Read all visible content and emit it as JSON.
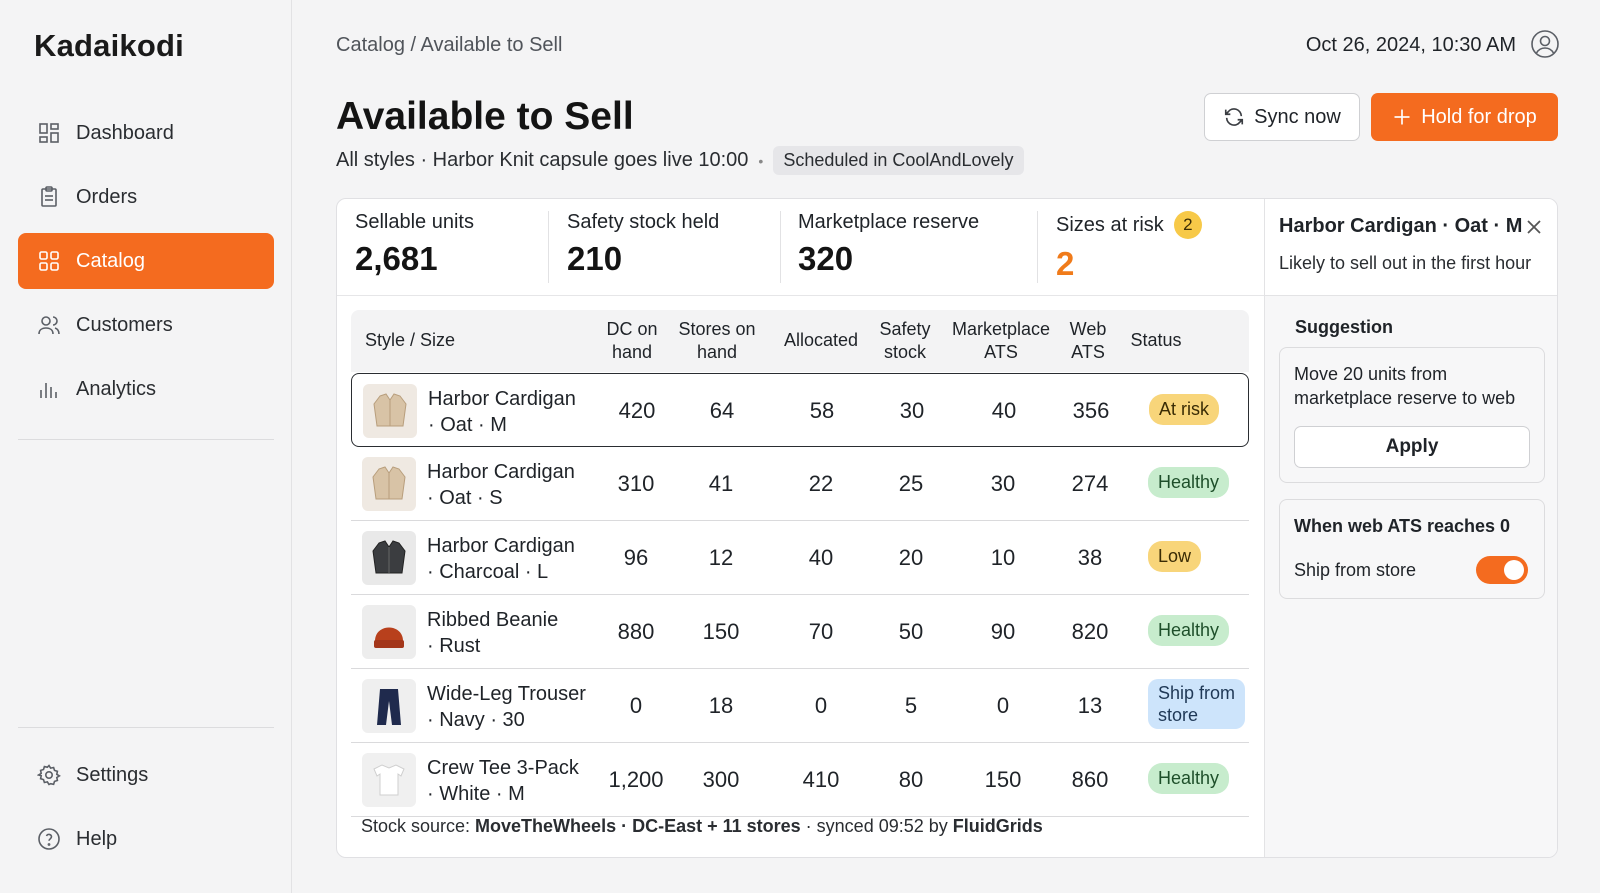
{
  "app": {
    "brand": "Kadaikodi"
  },
  "nav": {
    "items": [
      {
        "label": "Dashboard",
        "icon": "dashboard-icon"
      },
      {
        "label": "Orders",
        "icon": "clipboard-icon"
      },
      {
        "label": "Catalog",
        "icon": "grid-icon",
        "active": true
      },
      {
        "label": "Customers",
        "icon": "users-icon"
      },
      {
        "label": "Analytics",
        "icon": "bar-chart-icon"
      }
    ],
    "bottom": [
      {
        "label": "Settings",
        "icon": "gear-icon"
      },
      {
        "label": "Help",
        "icon": "help-icon"
      }
    ]
  },
  "header": {
    "breadcrumb": "Catalog / Available to Sell",
    "datetime": "Oct 26, 2024, 10:30 AM"
  },
  "page": {
    "title": "Available to Sell",
    "subtitle": "All styles · Harbor Knit capsule goes live 10:00",
    "separator": "•",
    "scheduled": "Scheduled in CoolAndLovely",
    "sync_label": "Sync now",
    "hold_label": "Hold for drop"
  },
  "kpis": {
    "sellable_label": "Sellable units",
    "sellable_value": "2,681",
    "safety_label": "Safety stock held",
    "safety_value": "210",
    "reserve_label": "Marketplace reserve",
    "reserve_value": "320",
    "risk_label": "Sizes at risk",
    "risk_badge": "2",
    "risk_value": "2"
  },
  "table": {
    "headers": {
      "style": "Style / Size",
      "dc": [
        "DC on",
        "hand"
      ],
      "stores": [
        "Stores on",
        "hand"
      ],
      "allocated": "Allocated",
      "safety": [
        "Safety",
        "stock"
      ],
      "marketplace": [
        "Marketplace",
        "ATS"
      ],
      "web": [
        "Web",
        "ATS"
      ],
      "status": "Status"
    },
    "rows": [
      {
        "name1": "Harbor Cardigan",
        "name2": "· Oat · M",
        "dc": "420",
        "stores": "64",
        "allocated": "58",
        "safety": "30",
        "marketplace": "40",
        "web": "356",
        "status": "At risk"
      },
      {
        "name1": "Harbor Cardigan",
        "name2": "· Oat · S",
        "dc": "310",
        "stores": "41",
        "allocated": "22",
        "safety": "25",
        "marketplace": "30",
        "web": "274",
        "status": "Healthy"
      },
      {
        "name1": "Harbor Cardigan",
        "name2": "· Charcoal · L",
        "dc": "96",
        "stores": "12",
        "allocated": "40",
        "safety": "20",
        "marketplace": "10",
        "web": "38",
        "status": "Low"
      },
      {
        "name1": "Ribbed Beanie",
        "name2": "· Rust",
        "dc": "880",
        "stores": "150",
        "allocated": "70",
        "safety": "50",
        "marketplace": "90",
        "web": "820",
        "status": "Healthy"
      },
      {
        "name1": "Wide-Leg Trouser",
        "name2": "· Navy · 30",
        "dc": "0",
        "stores": "18",
        "allocated": "0",
        "safety": "5",
        "marketplace": "0",
        "web": "13",
        "status1": "Ship from",
        "status2": "store"
      },
      {
        "name1": "Crew Tee 3-Pack",
        "name2": "· White · M",
        "dc": "1,200",
        "stores": "300",
        "allocated": "410",
        "safety": "80",
        "marketplace": "150",
        "web": "860",
        "status": "Healthy"
      }
    ]
  },
  "source": {
    "prefix": "Stock source: ",
    "system": "MoveTheWheels",
    "sep1": " · ",
    "location": "DC-East + 11 stores",
    "middle": " · synced 09:52 by ",
    "syncer": "FluidGrids"
  },
  "panel": {
    "title": "Harbor Cardigan · Oat · M",
    "subtitle": "Likely to sell out in the first hour",
    "suggestion_label": "Suggestion",
    "suggestion_text": "Move 20 units from marketplace reserve to web",
    "apply_label": "Apply",
    "rule_title": "When web ATS reaches 0",
    "rule_label": "Ship from store",
    "rule_enabled": true
  },
  "colors": {
    "accent": "#f46b1f",
    "healthy": "#c7eccd",
    "risk": "#f8d57a",
    "ship": "#cde4fb"
  }
}
